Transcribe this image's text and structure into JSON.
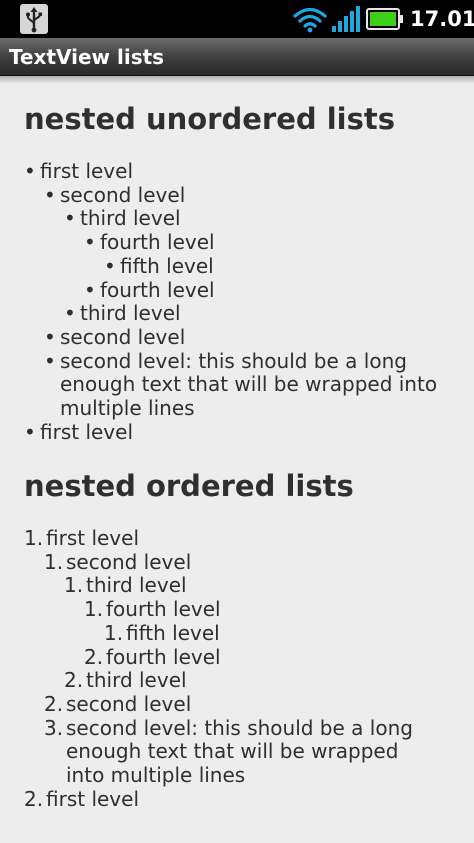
{
  "status_bar": {
    "usb_icon": "usb-icon",
    "wifi_icon": "wifi-icon",
    "signal_icon": "signal-icon",
    "battery_icon": "battery-icon",
    "battery_color": "#3ecf1a",
    "accent_color": "#1ea7e1",
    "time": "17.01"
  },
  "action_bar": {
    "title": "TextView lists"
  },
  "unordered": {
    "heading": "nested unordered lists",
    "bullet": "•",
    "items": [
      "first level",
      "second level",
      "third level",
      "fourth level",
      "fifth level",
      "fourth level",
      "third level",
      "second level",
      "second level: this should be a long enough text that will be wrapped into multiple lines",
      "first level"
    ]
  },
  "ordered": {
    "heading": "nested ordered lists",
    "items": [
      {
        "number": "1.",
        "text": "first level"
      },
      {
        "number": "1.",
        "text": "second level"
      },
      {
        "number": "1.",
        "text": "third level"
      },
      {
        "number": "1.",
        "text": "fourth level"
      },
      {
        "number": "1.",
        "text": "fifth level"
      },
      {
        "number": "2.",
        "text": "fourth level"
      },
      {
        "number": "2.",
        "text": "third level"
      },
      {
        "number": "2.",
        "text": "second level"
      },
      {
        "number": "3.",
        "text": "second level: this should be a long enough text that will be wrapped into multiple lines"
      },
      {
        "number": "2.",
        "text": "first level"
      }
    ]
  }
}
